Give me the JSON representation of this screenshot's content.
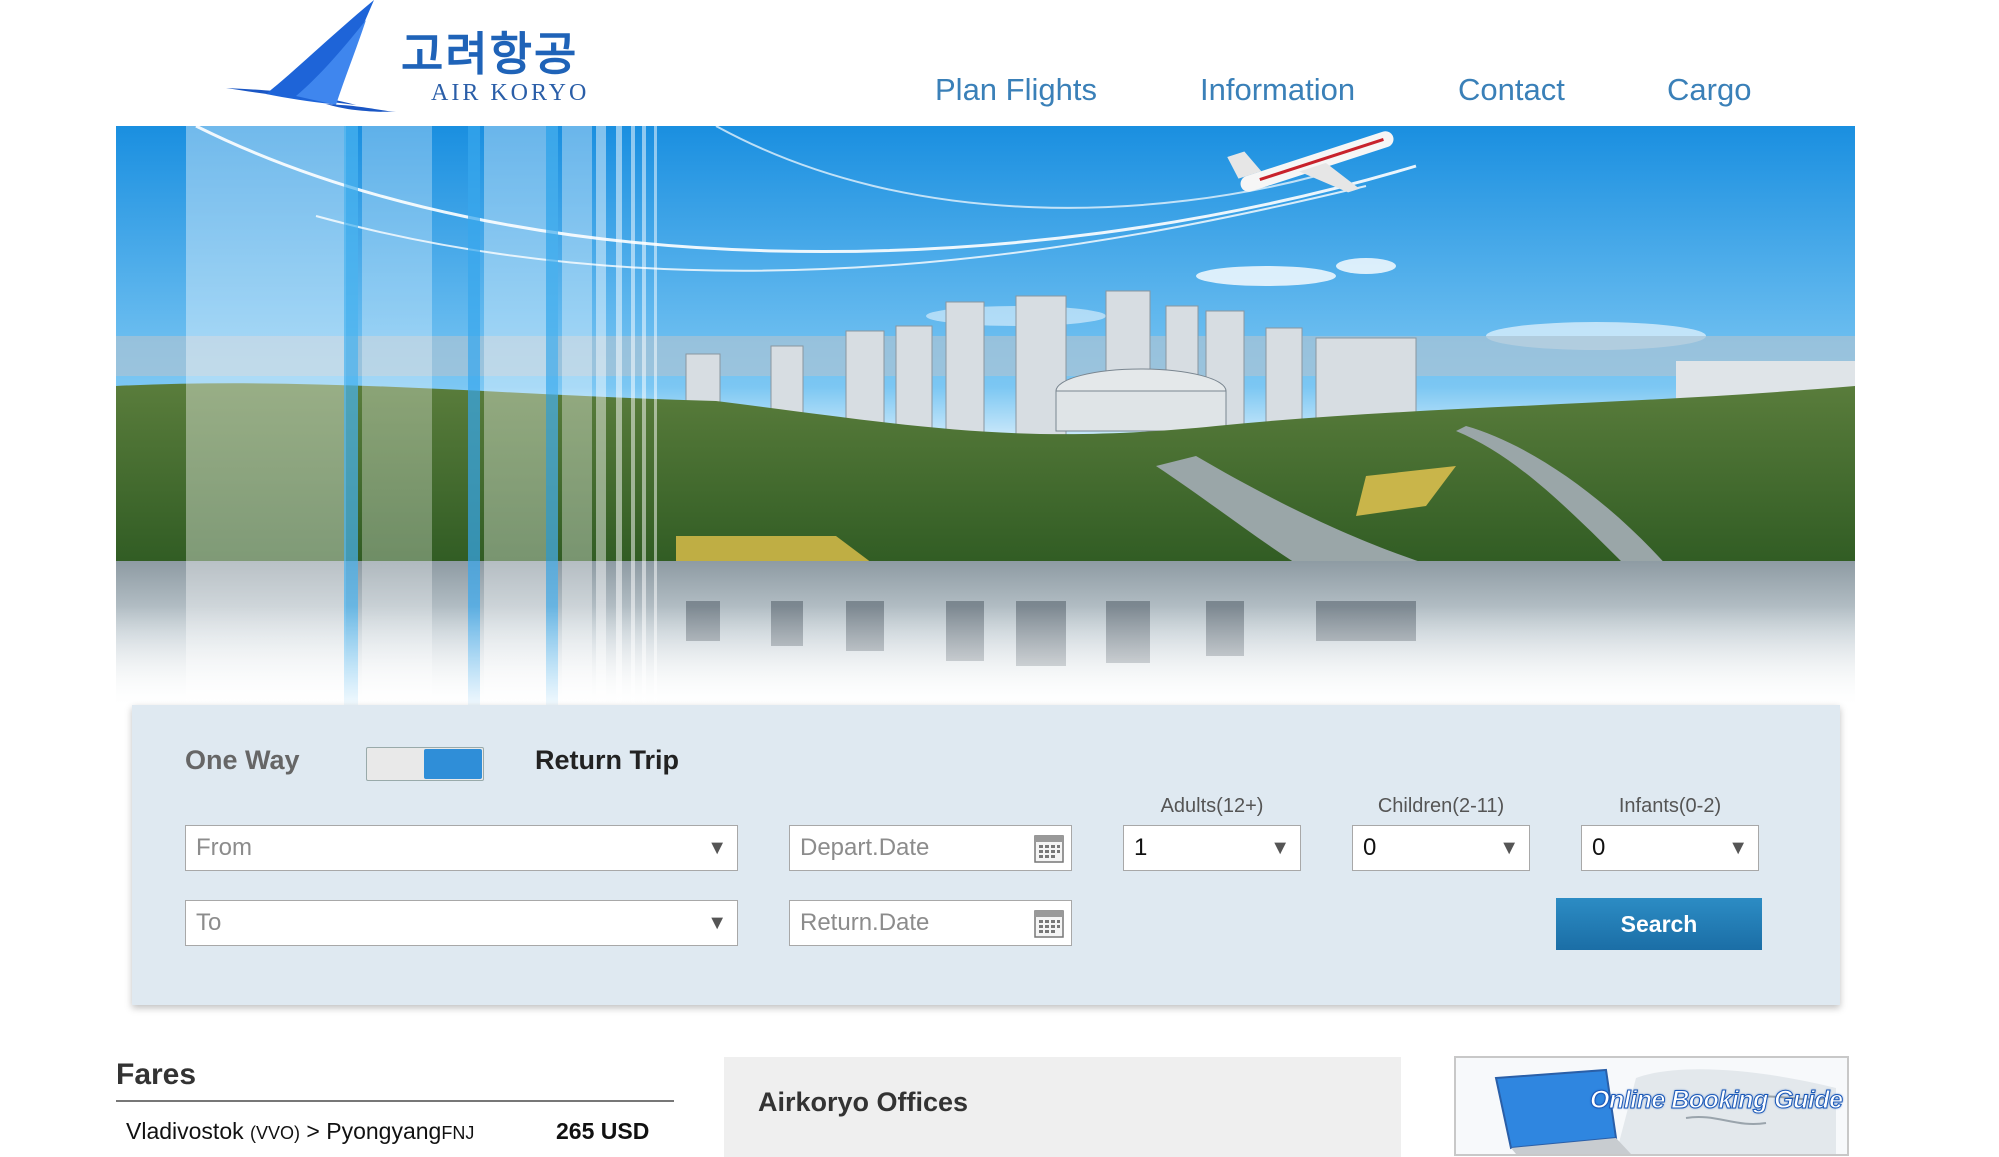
{
  "brand": {
    "hangul": "고려항공",
    "name": "AIR KORYO",
    "color": "#1f63b8"
  },
  "nav": {
    "items": [
      {
        "label": "Plan Flights"
      },
      {
        "label": "Information"
      },
      {
        "label": "Contact"
      },
      {
        "label": "Cargo"
      }
    ],
    "color": "#3a80b8"
  },
  "hero": {
    "image": "Pyongyang city skyline with Air Koryo airliner"
  },
  "booking": {
    "trip_type": {
      "one_way": "One Way",
      "return": "Return Trip",
      "selected": "Return Trip"
    },
    "from": {
      "placeholder": "From"
    },
    "to": {
      "placeholder": "To"
    },
    "depart": {
      "placeholder": "Depart.Date"
    },
    "return_date": {
      "placeholder": "Return.Date"
    },
    "adults": {
      "label": "Adults(12+)",
      "value": "1"
    },
    "children": {
      "label": "Children(2-11)",
      "value": "0"
    },
    "infants": {
      "label": "Infants(0-2)",
      "value": "0"
    },
    "search_label": "Search",
    "accent": "#2f8ed8"
  },
  "fares": {
    "title": "Fares",
    "rows": [
      {
        "from": "Vladivostok",
        "from_code": "(VVO)",
        "sep": ">",
        "to": "Pyongyang",
        "to_code": "FNJ",
        "price": "265 USD"
      }
    ]
  },
  "offices": {
    "title": "Airkoryo Offices"
  },
  "guide": {
    "label": "Online Booking Guide"
  }
}
